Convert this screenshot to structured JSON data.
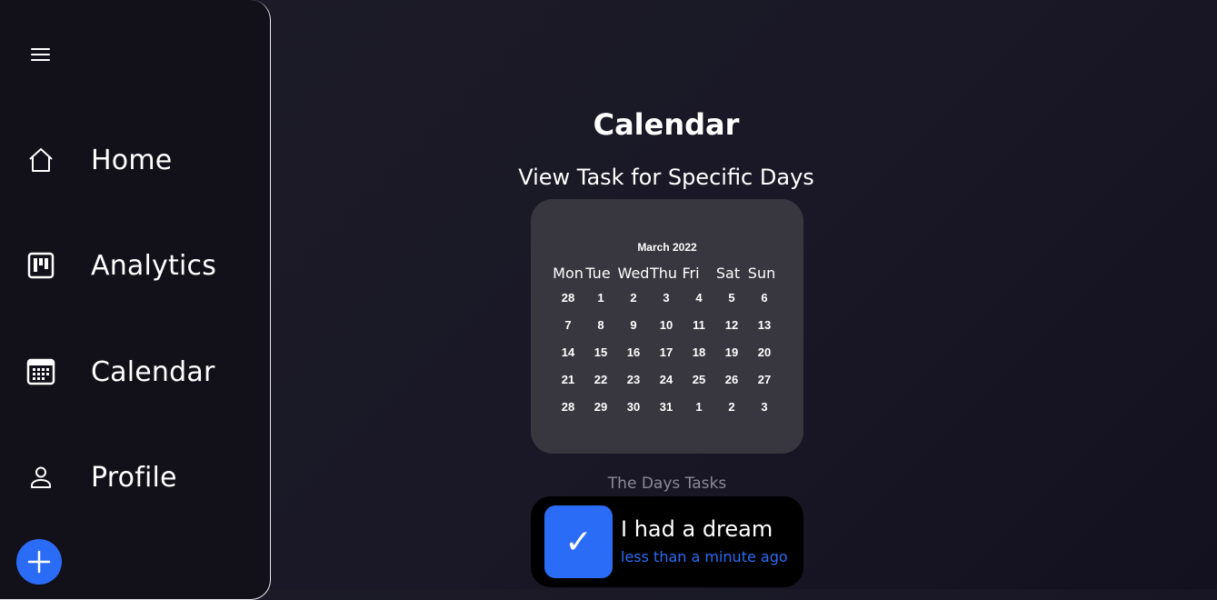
{
  "sidebar": {
    "menu_icon": "hamburger-icon",
    "items": [
      {
        "label": "Home",
        "icon": "home-icon"
      },
      {
        "label": "Analytics",
        "icon": "kanban-icon"
      },
      {
        "label": "Calendar",
        "icon": "calendar-icon"
      },
      {
        "label": "Profile",
        "icon": "person-icon"
      }
    ],
    "fab_icon": "plus-icon"
  },
  "main": {
    "title": "Calendar",
    "subtitle": "View Task for Specific Days"
  },
  "calendar": {
    "month_label": "March 2022",
    "weekdays": [
      "Mon",
      "Tue",
      "Wed",
      "Thu",
      "Fri",
      "Sat",
      "Sun"
    ],
    "weeks": [
      [
        "28",
        "1",
        "2",
        "3",
        "4",
        "5",
        "6"
      ],
      [
        "7",
        "8",
        "9",
        "10",
        "11",
        "12",
        "13"
      ],
      [
        "14",
        "15",
        "16",
        "17",
        "18",
        "19",
        "20"
      ],
      [
        "21",
        "22",
        "23",
        "24",
        "25",
        "26",
        "27"
      ],
      [
        "28",
        "29",
        "30",
        "31",
        "1",
        "2",
        "3"
      ]
    ]
  },
  "tasks": {
    "section_label": "The Days Tasks",
    "items": [
      {
        "title": "I had a dream",
        "time": "less than a minute ago",
        "check": "✓"
      }
    ]
  },
  "colors": {
    "accent": "#2b6cf6",
    "sidebar_bg": "#121019",
    "calendar_bg": "#38373f"
  }
}
